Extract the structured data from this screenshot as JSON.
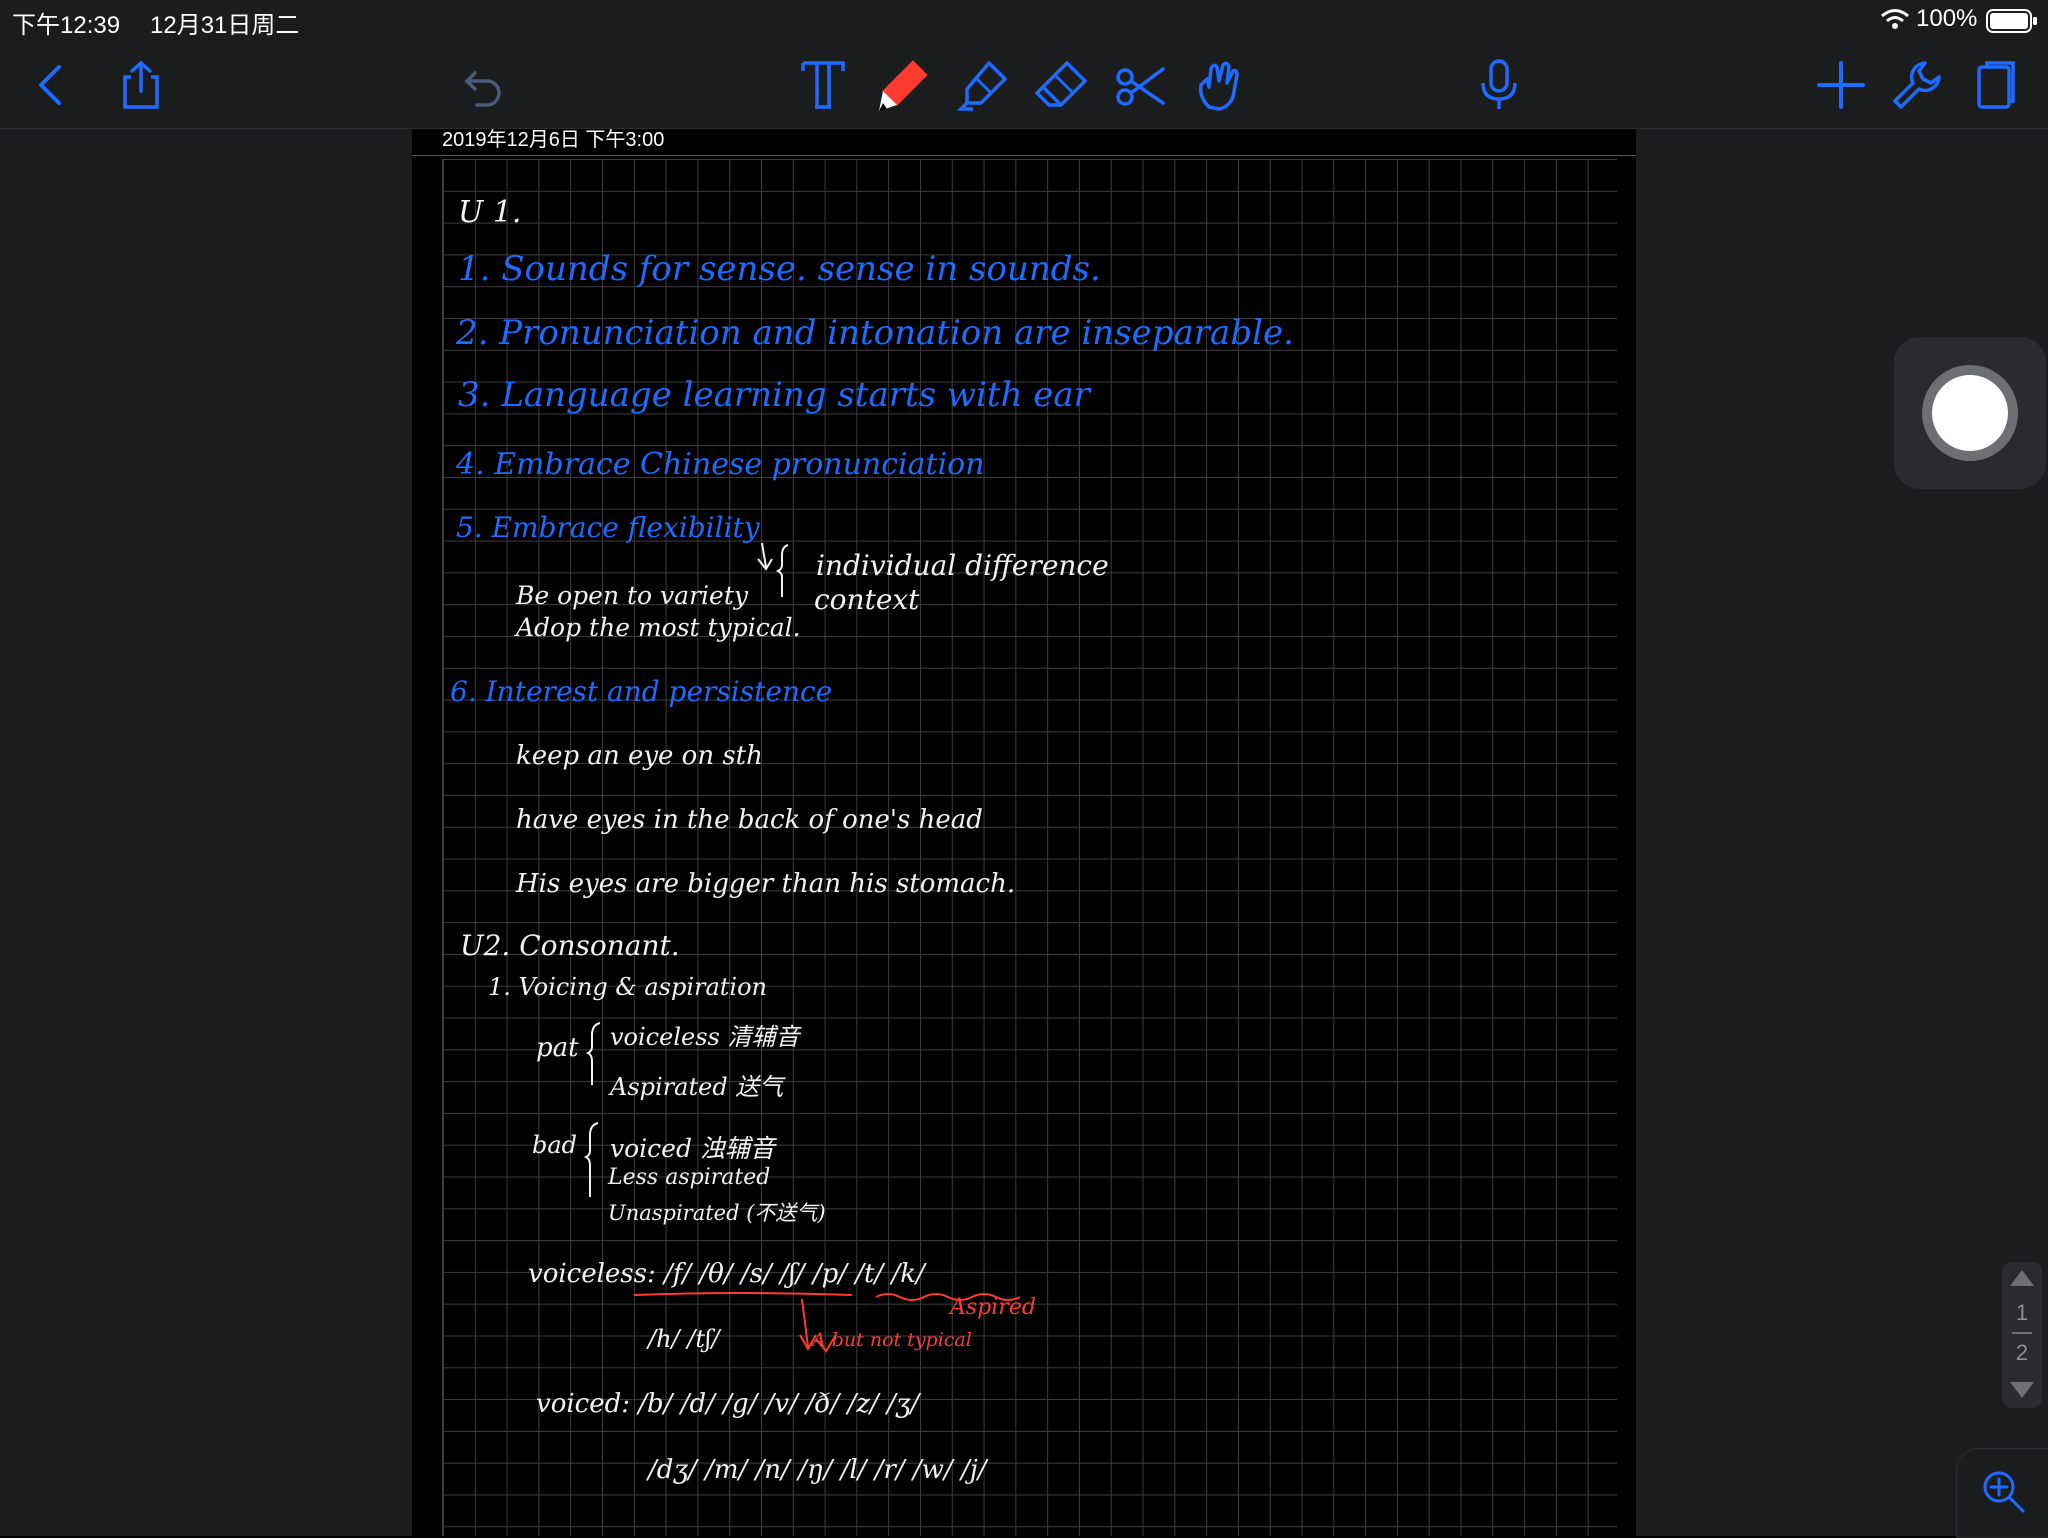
{
  "status_bar": {
    "time": "下午12:39",
    "date": "12月31日周二",
    "battery_percent": "100%",
    "battery_level": 1.0
  },
  "toolbar": {
    "left_icons": [
      "back-icon",
      "share-icon",
      "undo-icon"
    ],
    "tools": [
      "text-tool-icon",
      "pen-tool-icon",
      "highlighter-tool-icon",
      "eraser-tool-icon",
      "scissors-tool-icon",
      "hand-tool-icon"
    ],
    "right_icons": [
      "microphone-icon",
      "add-icon",
      "wrench-icon",
      "pages-icon"
    ],
    "active_tool_color": "#ff3b30",
    "icon_color": "#1e6bff"
  },
  "page": {
    "date_header": "2019年12月6日 下午3:00"
  },
  "notes": {
    "u1_title": "U 1.",
    "item1": "1. Sounds for sense. sense in sounds.",
    "item2": "2. Pronunciation and intonation are inseparable.",
    "item3": "3. Language learning starts with ear",
    "item4": "4. Embrace Chinese pronunciation",
    "item5": "5. Embrace flexibility",
    "item5_sub1": "individual difference",
    "item5_sub2": "context",
    "item5_line1": "Be open to variety",
    "item5_line2": "Adop the most typical.",
    "item6": "6. Interest and persistence",
    "idiom1": "keep an eye on sth",
    "idiom2": "have eyes in the back of one's head",
    "idiom3": "His eyes are bigger than his stomach.",
    "u2_title": "U2. Consonant.",
    "u2_item1": "1. Voicing & aspiration",
    "pat": "pat",
    "pat_sub1": "voiceless 清辅音",
    "pat_sub2": "Aspirated 送气",
    "bad": "bad",
    "bad_sub1": "voiced 浊辅音",
    "bad_sub2": "Less aspirated",
    "bad_sub3": "Unaspirated (不送气)",
    "voiceless_row": "voiceless: /f/ /θ/ /s/ /ʃ/ /p/ /t/ /k/",
    "aspired_note": "Aspired",
    "voiceless_row2": "/h/ /tʃ/",
    "arrow_note": "A but not typical",
    "voiced_row": "voiced: /b/ /d/ /g/ /v/ /ð/ /z/ /ʒ/",
    "voiced_row2": "/dʒ/ /m/ /n/ /ŋ/ /l/ /r/ /w/ /j/"
  },
  "pager": {
    "current": "1",
    "total": "2"
  },
  "colors": {
    "ink_blue": "#1e6bff",
    "ink_white": "#f2f2f2",
    "ink_red": "#ff3b30",
    "chrome": "#1b1c1e"
  }
}
